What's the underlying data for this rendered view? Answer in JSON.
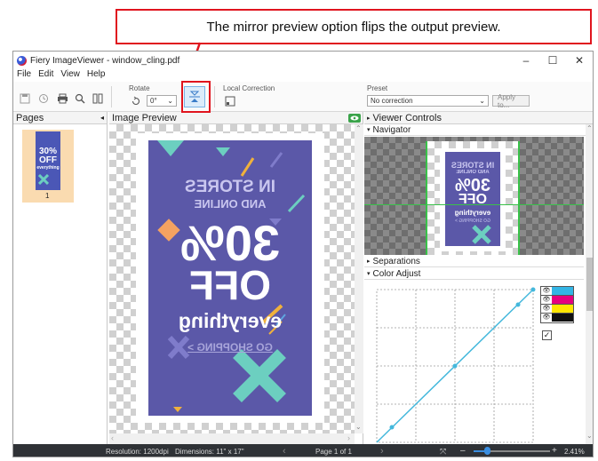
{
  "callout": {
    "text": "The mirror preview option flips the output preview."
  },
  "window": {
    "title": "Fiery ImageViewer - window_cling.pdf",
    "controls": {
      "minimize": "–",
      "maximize": "☐",
      "close": "✕"
    }
  },
  "menu": {
    "file": "File",
    "edit": "Edit",
    "view": "View",
    "help": "Help"
  },
  "toolbar": {
    "rotate_label": "Rotate",
    "rotate_value": "0°",
    "local_correction_label": "Local Correction",
    "preset_label": "Preset",
    "preset_value": "No correction",
    "apply_label": "Apply to..."
  },
  "pages": {
    "title": "Pages",
    "thumbnail_number": "1"
  },
  "preview": {
    "title": "Image Preview"
  },
  "poster": {
    "line1": "IN STORES",
    "line2": "AND ONLINE",
    "percent": "30%",
    "off": "OFF",
    "everything": "everything",
    "shopping": "GO SHOPPING >"
  },
  "viewer": {
    "title": "Viewer Controls",
    "navigator": "Navigator",
    "separations": "Separations",
    "color_adjust": "Color Adjust"
  },
  "status": {
    "resolution": "Resolution: 1200dpi",
    "dimensions": "Dimensions: 11\" x 17\"",
    "page": "Page 1 of 1",
    "zoom": "2.41%"
  },
  "colors": {
    "poster_bg": "#5b58a8",
    "curve": "#44b8dc",
    "highlight": "#e0141e",
    "teal": "#6ccfc0"
  }
}
